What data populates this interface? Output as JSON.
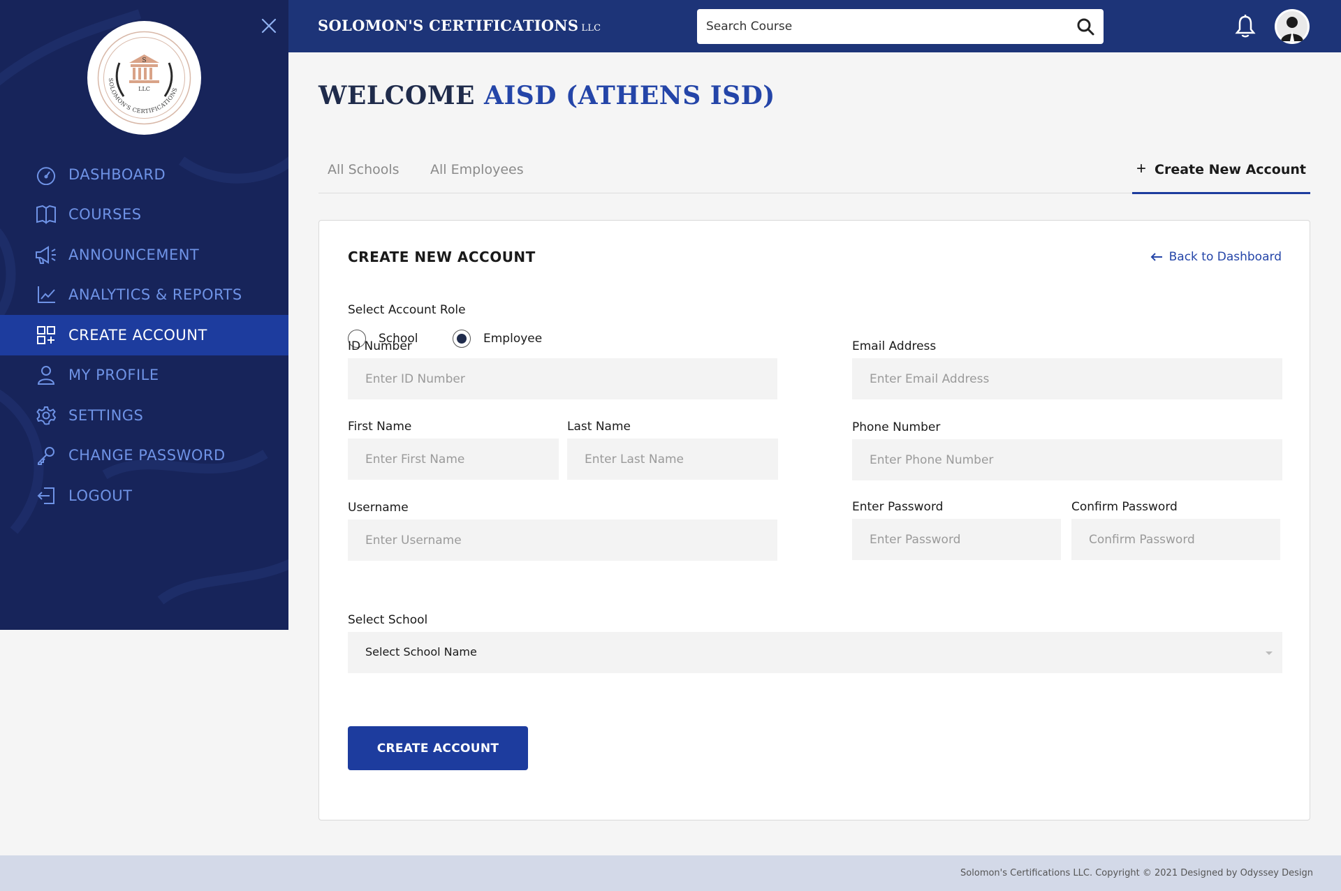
{
  "brand": {
    "name": "SOLOMON'S CERTIFICATIONS",
    "suffix": "LLC"
  },
  "logo": {
    "text_top": "S",
    "text_mid": "LLC",
    "text_arc": "SOLOMON'S CERTIFICATIONS"
  },
  "search": {
    "placeholder": "Search Course"
  },
  "sidebar": {
    "items": [
      {
        "label": "DASHBOARD",
        "icon": "dashboard-gauge-icon"
      },
      {
        "label": "COURSES",
        "icon": "open-book-icon"
      },
      {
        "label": "ANNOUNCEMENT",
        "icon": "megaphone-icon"
      },
      {
        "label": "ANALYTICS & REPORTS",
        "icon": "line-chart-icon"
      },
      {
        "label": "CREATE ACCOUNT",
        "icon": "grid-add-icon",
        "active": true
      },
      {
        "label": "MY PROFILE",
        "icon": "user-icon"
      },
      {
        "label": "SETTINGS",
        "icon": "gear-icon"
      },
      {
        "label": "CHANGE PASSWORD",
        "icon": "key-icon"
      },
      {
        "label": "LOGOUT",
        "icon": "logout-icon"
      }
    ]
  },
  "welcome": {
    "prefix": "WELCOME",
    "name": "AISD (ATHENS ISD)"
  },
  "tabs": {
    "all_schools": "All Schools",
    "all_employees": "All Employees",
    "create_new": "Create New Account"
  },
  "form": {
    "title": "CREATE NEW ACCOUNT",
    "back_link": "Back to Dashboard",
    "role_label": "Select Account Role",
    "roles": [
      {
        "label": "School",
        "checked": false
      },
      {
        "label": "Employee",
        "checked": true
      }
    ],
    "id_number": {
      "label": "ID Number",
      "placeholder": "Enter ID Number"
    },
    "email": {
      "label": "Email Address",
      "placeholder": "Enter Email Address"
    },
    "first_name": {
      "label": "First Name",
      "placeholder": "Enter First Name"
    },
    "last_name": {
      "label": "Last Name",
      "placeholder": "Enter Last Name"
    },
    "phone": {
      "label": "Phone Number",
      "placeholder": "Enter Phone Number"
    },
    "username": {
      "label": "Username",
      "placeholder": "Enter Username"
    },
    "password": {
      "label": "Enter Password",
      "placeholder": "Enter Password"
    },
    "confirm_password": {
      "label": "Confirm Password",
      "placeholder": "Confirm Password"
    },
    "school": {
      "label": "Select School",
      "value": "Select School Name"
    },
    "submit": "CREATE ACCOUNT"
  },
  "footer": {
    "text": "Solomon's Certifications LLC. Copyright © 2021 Designed by Odyssey Design"
  },
  "colors": {
    "sidebar_bg": "#17245a",
    "header_bg": "#1d3478",
    "accent": "#1d3c9e",
    "nav_text": "#6f93e6"
  }
}
